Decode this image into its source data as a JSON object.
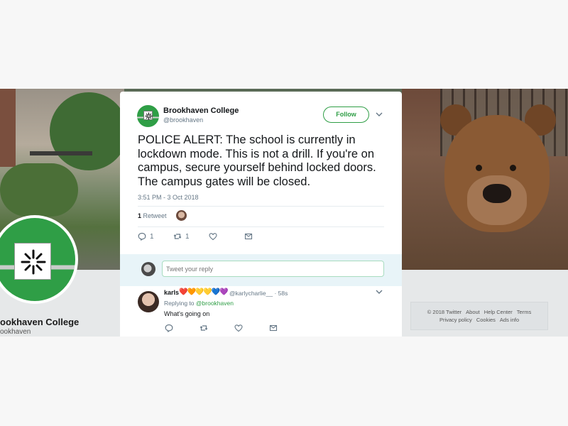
{
  "profile": {
    "name": "Brookhaven College",
    "name_visible": "ookhaven College",
    "handle_visible": "ookhaven"
  },
  "tweet": {
    "author_name": "Brookhaven College",
    "author_handle": "@brookhaven",
    "follow_label": "Follow",
    "text": "POLICE ALERT: The school is currently in lockdown mode. This is not a drill. If you're on campus, secure yourself behind locked doors. The campus gates will be closed.",
    "timestamp": "3:51 PM - 3 Oct 2018",
    "retweet_count": "1",
    "retweet_label": "Retweet",
    "reply_count": "1",
    "rt_count": "1"
  },
  "reply_box": {
    "placeholder": "Tweet your reply"
  },
  "reply": {
    "author_name": "karls",
    "hearts": "❤️🧡💛💛💙💜",
    "author_handle": "@karlycharlie__",
    "time": "· 58s",
    "replying_prefix": "Replying to",
    "replying_to": "@brookhaven",
    "text": "What's going on"
  },
  "footer": {
    "links": [
      "© 2018 Twitter",
      "About",
      "Help Center",
      "Terms",
      "Privacy policy",
      "Cookies",
      "Ads info"
    ]
  },
  "colors": {
    "brand_green": "#2f9e46",
    "reply_bar": "#e8f4f8",
    "text_muted": "#657786"
  }
}
